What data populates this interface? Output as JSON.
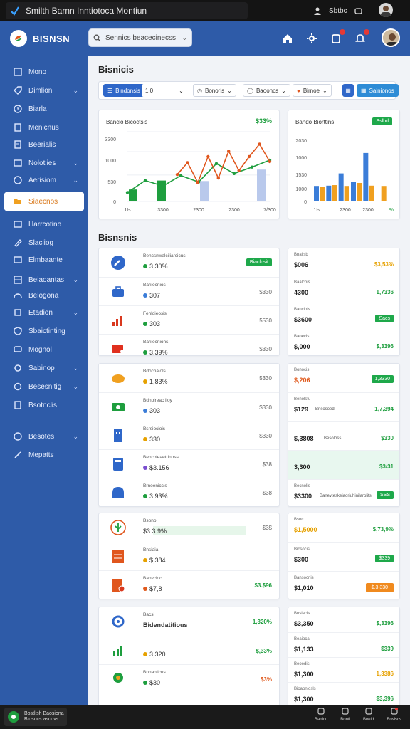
{
  "window": {
    "title": "Smilth Barnn Inntiotoca Montiun"
  },
  "titlebar": {
    "status": "Sbtbc"
  },
  "header": {
    "brand": "BISNSN",
    "search_placeholder": "Sennics beacecinecss"
  },
  "sidebar": {
    "items": [
      {
        "label": "Mono",
        "icon": "grid-icon"
      },
      {
        "label": "Dimlion",
        "icon": "tag-icon",
        "chevron": true
      },
      {
        "label": "Biarla",
        "icon": "clock-icon"
      },
      {
        "label": "Menicnus",
        "icon": "file-icon"
      },
      {
        "label": "Beerialis",
        "icon": "document-icon"
      },
      {
        "label": "Nolotlies",
        "icon": "card-icon",
        "chevron": true
      },
      {
        "label": "Aerisiom",
        "icon": "compass-icon",
        "chevron": true
      },
      {
        "label": "Siaecnos",
        "icon": "folder-icon",
        "active": true
      },
      {
        "label": "Harrcotino",
        "icon": "list-icon"
      },
      {
        "label": "Slacliog",
        "icon": "pen-icon"
      },
      {
        "label": "Elmbaante",
        "icon": "image-icon"
      },
      {
        "label": "Beiaoantas",
        "icon": "table-icon",
        "chevron": true
      },
      {
        "label": "Belogona",
        "icon": "gauge-icon"
      },
      {
        "label": "Etadion",
        "icon": "box-icon",
        "chevron": true
      },
      {
        "label": "Sbaictinting",
        "icon": "shield-icon"
      },
      {
        "label": "Mognol",
        "icon": "chat-icon"
      },
      {
        "label": "Sabinop",
        "icon": "settings-icon",
        "chevron": true
      },
      {
        "label": "Besesnltig",
        "icon": "users-icon",
        "chevron": true
      },
      {
        "label": "Bsotnclis",
        "icon": "report-icon"
      },
      {
        "label": "Besotes",
        "icon": "question-icon",
        "chevron": true
      },
      {
        "label": "Mepatts",
        "icon": "link-icon"
      }
    ]
  },
  "section1": {
    "title": "Bisnicis"
  },
  "filters": {
    "primary": "Bindonsis",
    "period": "1I0",
    "f2": "Bonoris",
    "f3": "Baooncs",
    "f4": "Birnoe",
    "action": "Salnionos"
  },
  "chart_main": {
    "title": "Banclo Bicoctsis",
    "value": "$33%",
    "tick_labels_y": [
      "3300",
      "1000",
      "530",
      "0"
    ],
    "tick_labels_x": [
      "1Is",
      "3300",
      "2300",
      "2300",
      "7/300"
    ]
  },
  "chart_side": {
    "title": "Bando Biorttins",
    "badge": "Sslbd",
    "tick_labels_y": [
      "2030",
      "1000",
      "1530",
      "1000",
      "0"
    ],
    "tick_labels_x": [
      "1Is",
      "2300",
      "2300"
    ],
    "corner_label": "%"
  },
  "chart_data": [
    {
      "type": "line",
      "title": "Banclo Bicoctsis",
      "categories": [
        "1Is",
        "3300",
        "2300",
        "2300",
        "7/300"
      ],
      "series": [
        {
          "color": "#1e9e3e",
          "values": [
            180,
            420,
            310,
            520,
            390,
            760,
            560,
            690,
            830
          ]
        },
        {
          "color": "#e0561d",
          "values": [
            540,
            780,
            380,
            900,
            470,
            1010,
            620,
            900,
            1150,
            800
          ]
        }
      ],
      "bars": [
        {
          "color": "#1e9e3e",
          "values": [
            240,
            420,
            0,
            0,
            0,
            0
          ]
        },
        {
          "color": "#b9c9ec",
          "values": [
            0,
            0,
            410,
            0,
            640,
            0
          ]
        }
      ],
      "ylim": [
        0,
        1400
      ]
    },
    {
      "type": "bar",
      "title": "Bando Biorttins",
      "categories": [
        "1Is",
        "2300",
        "2300"
      ],
      "series": [
        {
          "color": "#3b7dd8",
          "values": [
            570,
            580,
            1030,
            730,
            1780,
            0
          ]
        },
        {
          "color": "#f0a020",
          "values": [
            540,
            600,
            570,
            680,
            580,
            570
          ]
        }
      ],
      "ylim": [
        0,
        2300
      ]
    }
  ],
  "section2": {
    "title": "Bisnsnis"
  },
  "group1": {
    "rows": [
      {
        "label": "Bencsnwalciliarcicus",
        "value": "3,30%",
        "dot": "#1e9e3e",
        "right": "Biaclnsit",
        "right_badge": true,
        "icon": "wrench-icon"
      },
      {
        "label": "Bariiocnios",
        "value": "307",
        "dot": "#3b7dd8",
        "right": "$330",
        "icon": "briefcase-icon"
      },
      {
        "label": "Fenloieosis",
        "value": "303",
        "dot": "#1e9e3e",
        "right": "5530",
        "icon": "chart-icon"
      },
      {
        "label": "Bariiocnions",
        "value": "3.39%",
        "dot": "#1e9e3e",
        "right": "$330",
        "icon": "ticket-icon"
      }
    ],
    "side": [
      {
        "label": "Bnaiisb",
        "value": "$006",
        "right": "$3,53%",
        "right_color": "#e6a100"
      },
      {
        "label": "Baalcois",
        "value": "4300",
        "right": "1,7336",
        "right_color": "#1e9e3e"
      },
      {
        "label": "Banciois",
        "value": "$3600",
        "right": "Sacs",
        "right_badge": true
      },
      {
        "label": "Baoecis",
        "value": "$,000",
        "right": "$,3396",
        "right_color": "#1e9e3e"
      }
    ]
  },
  "group2": {
    "rows": [
      {
        "label": "Bdocriaiols",
        "value": "1,83%",
        "dot": "#e6a100",
        "right": "5330",
        "icon": "cloud-icon"
      },
      {
        "label": "Bdnoireac lioy",
        "value": "303",
        "dot": "#3b7dd8",
        "right": "$330",
        "icon": "money-icon"
      },
      {
        "label": "Bsrsiociois",
        "value": "330",
        "dot": "#e6a100",
        "right": "$330",
        "icon": "building-icon"
      },
      {
        "label": "Bencoleaetrinoss",
        "value": "$3.156",
        "dot": "#7a4fd0",
        "right": "$38",
        "icon": "calculator-icon"
      },
      {
        "label": "Brnoeniccis",
        "value": "3.93%",
        "dot": "#1e9e3e",
        "right": "$38",
        "icon": "dome-icon"
      }
    ],
    "side": [
      {
        "label": "Bonocis",
        "value": "$,206",
        "value_color": "#e05a1d",
        "right": "1,3330",
        "right_badge": true
      },
      {
        "label": "Benolstu",
        "value": "$129",
        "sub": "Bnsosoedi",
        "right": "1,7,394",
        "right_color": "#1e9e3e"
      },
      {
        "label": "",
        "value": "$,3808",
        "sub": "Besoloss",
        "right": "$330",
        "right_color": "#1e9e3e"
      },
      {
        "label": "",
        "value": "3,300",
        "right": "$3/31",
        "right_color": "#1e9e3e",
        "highlight": true
      },
      {
        "label": "Becnolis",
        "value": "$3300",
        "sub": "Banevteskeiaoriuhinilarolits",
        "right": "SSS",
        "right_badge": true
      }
    ]
  },
  "group3": {
    "rows": [
      {
        "label": "Bsono",
        "value": "$3.3.9%",
        "dot": "",
        "right": "$3$",
        "icon": "leaf-icon",
        "bar": true
      },
      {
        "label": "Bnsiaia",
        "value": "$,384",
        "dot": "#e6a100",
        "right": "",
        "icon": "grid-report-icon"
      },
      {
        "label": "Banvcioc",
        "value": "$7,8",
        "dot": "#e05a1d",
        "right": "$3.$96",
        "right_color": "#1e9e3e",
        "icon": "invoice-icon"
      }
    ],
    "side": [
      {
        "label": "Bsoc",
        "value": "$1,5000",
        "value_color": "#e6a100",
        "right": "$,73,9%",
        "right_color": "#1e9e3e"
      },
      {
        "label": "Bicsocis",
        "value": "$300",
        "right": "$339",
        "right_badge": true
      },
      {
        "label": "Bansocnis",
        "value": "$1,010",
        "right": "$.3.330",
        "right_orange": true
      }
    ]
  },
  "group4": {
    "rows": [
      {
        "label": "Bacsi",
        "value": "Bidendatitious",
        "bold": true,
        "right": "1,320%",
        "right_color": "#1e9e3e",
        "icon": "gear-network-icon"
      },
      {
        "label": "",
        "value": "3,320",
        "dot": "#e6a100",
        "right": "$,33%",
        "right_color": "#1e9e3e",
        "icon": "bars-icon"
      },
      {
        "label": "Bnnaoiicus",
        "value": "$30",
        "dot": "#1e9e3e",
        "right": "$3%",
        "right_color": "#e05a1d",
        "icon": "pin-icon"
      }
    ],
    "side": [
      {
        "label": "Bnsiacis",
        "value": "$3,350",
        "right": "$,3396",
        "right_color": "#1e9e3e"
      },
      {
        "label": "Beaioca",
        "value": "$1,133",
        "right": "$339",
        "right_color": "#1e9e3e"
      },
      {
        "label": "Beoedis",
        "value": "$1,300",
        "right": "1,3386",
        "right_color": "#e6a100"
      },
      {
        "label": "Bioaoniosls",
        "value": "$1,300",
        "right": "$3,396",
        "right_color": "#1e9e3e"
      }
    ]
  },
  "taskbar": {
    "app_label": "Bostlish Baosiona Blusocs ascovs",
    "tray": [
      "Banico",
      "Bontl",
      "Boeid",
      "Bosiscs"
    ]
  }
}
